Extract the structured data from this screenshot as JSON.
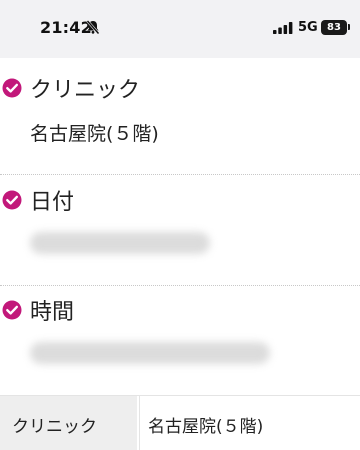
{
  "status_bar": {
    "time": "21:42",
    "network": "5G",
    "battery": "83",
    "icons": [
      "bell-slash-icon",
      "signal-bars-icon",
      "battery-icon"
    ]
  },
  "accent_color": "#c2187a",
  "sections": [
    {
      "title": "クリニック",
      "value": "名古屋院(５階)"
    },
    {
      "title": "日付"
    },
    {
      "title": "時間"
    }
  ],
  "summary_table": {
    "rows": [
      {
        "label": "クリニック",
        "value": "名古屋院(５階)"
      }
    ]
  }
}
